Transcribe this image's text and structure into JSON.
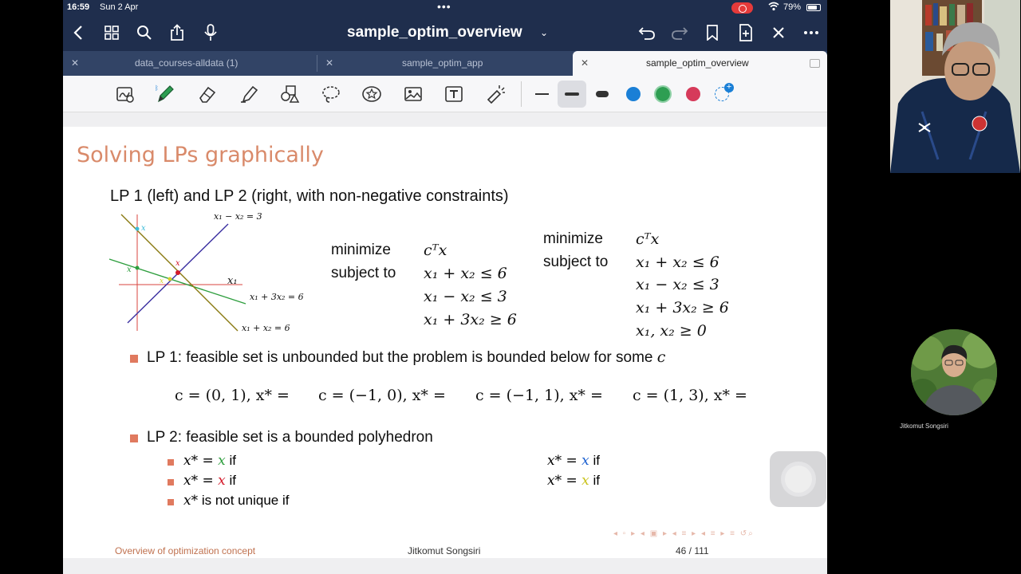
{
  "status": {
    "time": "16:59",
    "date": "Sun 2 Apr",
    "battery": "79%",
    "battery_level": 0.79
  },
  "nav": {
    "title": "sample_optim_overview",
    "icons": [
      "chevron-left-icon",
      "grid-icon",
      "search-icon",
      "share-icon",
      "mic-icon",
      "undo-icon",
      "redo-icon",
      "bookmark-icon",
      "add-page-icon",
      "close-icon",
      "more-icon"
    ]
  },
  "tabs": [
    {
      "label": "data_courses-alldata (1)",
      "active": false
    },
    {
      "label": "sample_optim_app",
      "active": false
    },
    {
      "label": "sample_optim_overview",
      "active": true
    }
  ],
  "toolbar": {
    "tools": [
      "lasso-zoom-icon",
      "pen-icon",
      "eraser-icon",
      "highlighter-icon",
      "shapes-icon",
      "lasso-icon",
      "sticker-icon",
      "image-icon",
      "text-icon",
      "laser-pointer-icon"
    ],
    "colors": [
      "#1a7fd6",
      "#2e9e52",
      "#d63a5a"
    ]
  },
  "slide": {
    "title": "Solving LPs graphically",
    "subtitle": "LP 1 (left) and LP 2 (right, with non-negative constraints)",
    "graph": {
      "line1": "x₁ − x₂ = 3",
      "line2": "x₁ + 3x₂ = 6",
      "line3": "x₁ + x₂ = 6",
      "axis": "x₁",
      "pt": "x"
    },
    "lp1": {
      "minimize": "minimize",
      "subject_to": "subject to",
      "objective": "cᵀx",
      "c1": "x₁ + x₂ ≤ 6",
      "c2": "x₁ − x₂ ≤ 3",
      "c3": "x₁ + 3x₂ ≥ 6"
    },
    "lp2": {
      "minimize": "minimize",
      "subject_to": "subject to",
      "objective": "cᵀx",
      "c1": "x₁ + x₂ ≤ 6",
      "c2": "x₁ − x₂ ≤ 3",
      "c3": "x₁ + 3x₂ ≥ 6",
      "c4": "x₁, x₂ ≥ 0"
    },
    "bullet1_text": "LP 1:  feasible set is unbounded but the problem is bounded below for some ",
    "bullet1_math": "c",
    "cvals": [
      "c = (0, 1), x* =",
      "c = (−1, 0), x* =",
      "c = (−1, 1), x* =",
      "c = (1, 3), x* ="
    ],
    "bullet2": "LP 2:  feasible set is a bounded polyhedron",
    "sub": {
      "a_prefix": "x* = ",
      "a_var": "x",
      "a_suffix": " if",
      "b_prefix": "x* = ",
      "b_var": "x",
      "b_suffix": " if",
      "c_prefix": "x*",
      "c_suffix": " is not unique if",
      "d_prefix": "x* = ",
      "d_var": "x",
      "d_suffix": " if",
      "e_prefix": "x* = ",
      "e_var": "x",
      "e_suffix": " if"
    },
    "footer_left": "Overview of optimization concept",
    "footer_mid": "Jitkomut Songsiri",
    "footer_right": "46 / 111"
  },
  "participant": {
    "name": "Jitkomut Songsiri"
  }
}
